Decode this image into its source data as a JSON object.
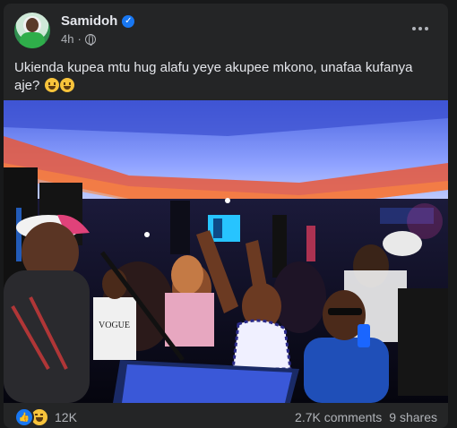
{
  "post": {
    "author": "Samidoh",
    "time": "4h",
    "separator": "·",
    "caption": "Ukienda kupea mtu hug alafu yeye akupee mkono, unafaa kufanya aje?",
    "caption_emojis": [
      "grinning-face",
      "grinning-face"
    ]
  },
  "photo": {
    "shirt_text": "VOGUE",
    "ceiling_color": "#5a6ee8",
    "accent_color": "#e8583a"
  },
  "footer": {
    "reaction_icons": [
      "like",
      "haha"
    ],
    "reactions_count": "12K",
    "comments": "2.7K comments",
    "shares": "9 shares"
  },
  "colors": {
    "background": "#18191a",
    "card": "#242526",
    "text": "#e4e6eb",
    "secondary": "#b0b3b8",
    "verified": "#1877f2"
  }
}
